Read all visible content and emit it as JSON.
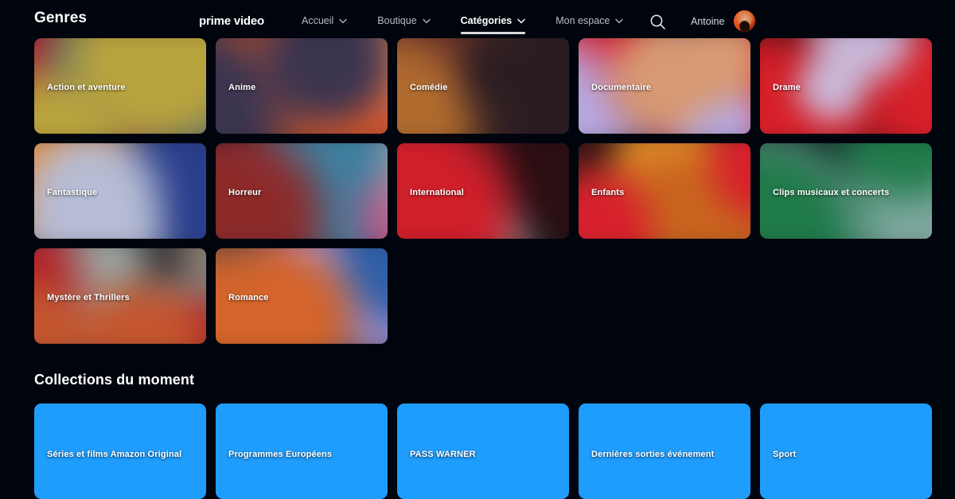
{
  "page": {
    "title": "Genres",
    "background": "#00050d"
  },
  "header": {
    "brand": "prime video",
    "nav": [
      {
        "label": "Accueil",
        "has_caret": true,
        "active": false
      },
      {
        "label": "Boutique",
        "has_caret": true,
        "active": false
      },
      {
        "label": "Catégories",
        "has_caret": true,
        "active": true
      },
      {
        "label": "Mon espace",
        "has_caret": true,
        "active": false
      }
    ],
    "search_icon": "search-icon",
    "user": {
      "name": "Antoine",
      "avatar_icon": "user-avatar"
    }
  },
  "genres": {
    "cards": [
      {
        "label": "Action et aventure",
        "colors": [
          "#b9a33d",
          "#3b5f7a",
          "#8e4a60",
          "#b01f2e",
          "#1c1a1e"
        ]
      },
      {
        "label": "Anime",
        "colors": [
          "#3b3550",
          "#d9552a",
          "#e2855a",
          "#9e2b1e",
          "#231a26"
        ]
      },
      {
        "label": "Comédie",
        "colors": [
          "#2a1d22",
          "#b06a2e",
          "#7a3a1e",
          "#5e2a2a",
          "#1a1216"
        ]
      },
      {
        "label": "Documentaire",
        "colors": [
          "#d79a72",
          "#b6a7e0",
          "#d81f2c",
          "#7fa8c0",
          "#2a1416"
        ]
      },
      {
        "label": "Drame",
        "colors": [
          "#c9b7d8",
          "#d61f28",
          "#a3141c",
          "#6c0f14",
          "#2a0c10"
        ]
      },
      {
        "label": "Fantastique",
        "colors": [
          "#b6bcd4",
          "#2a3f8c",
          "#e08a3a",
          "#1b2230",
          "#151a24"
        ]
      },
      {
        "label": "Horreur",
        "colors": [
          "#8c2a2a",
          "#3f7fa0",
          "#d9447e",
          "#9aa0a8",
          "#2a1a1e"
        ]
      },
      {
        "label": "International",
        "colors": [
          "#cf1f2a",
          "#8e8e90",
          "#7f1018",
          "#1e2230",
          "#2a0e12"
        ]
      },
      {
        "label": "Enfants",
        "colors": [
          "#d8202c",
          "#c8641e",
          "#e89a2a",
          "#3a1416",
          "#1e1216"
        ]
      },
      {
        "label": "Clips musicaux et concerts",
        "colors": [
          "#1f7a4a",
          "#b9b2d4",
          "#7fa8a0",
          "#16202a",
          "#101820"
        ]
      },
      {
        "label": "Mystère et Thrillers",
        "colors": [
          "#c4562e",
          "#b01f28",
          "#9aa4a0",
          "#8e8276",
          "#1a1016"
        ]
      },
      {
        "label": "Romance",
        "colors": [
          "#d4642a",
          "#2f5fa8",
          "#b79ad6",
          "#d8202c",
          "#3a4250"
        ]
      }
    ]
  },
  "collections": {
    "title": "Collections du moment",
    "accent_color": "#1f9dfc",
    "cards": [
      {
        "label": "Séries et films Amazon Original"
      },
      {
        "label": "Programmes Européens"
      },
      {
        "label": "PASS WARNER"
      },
      {
        "label": "Dernières sorties événement"
      },
      {
        "label": "Sport"
      }
    ]
  }
}
